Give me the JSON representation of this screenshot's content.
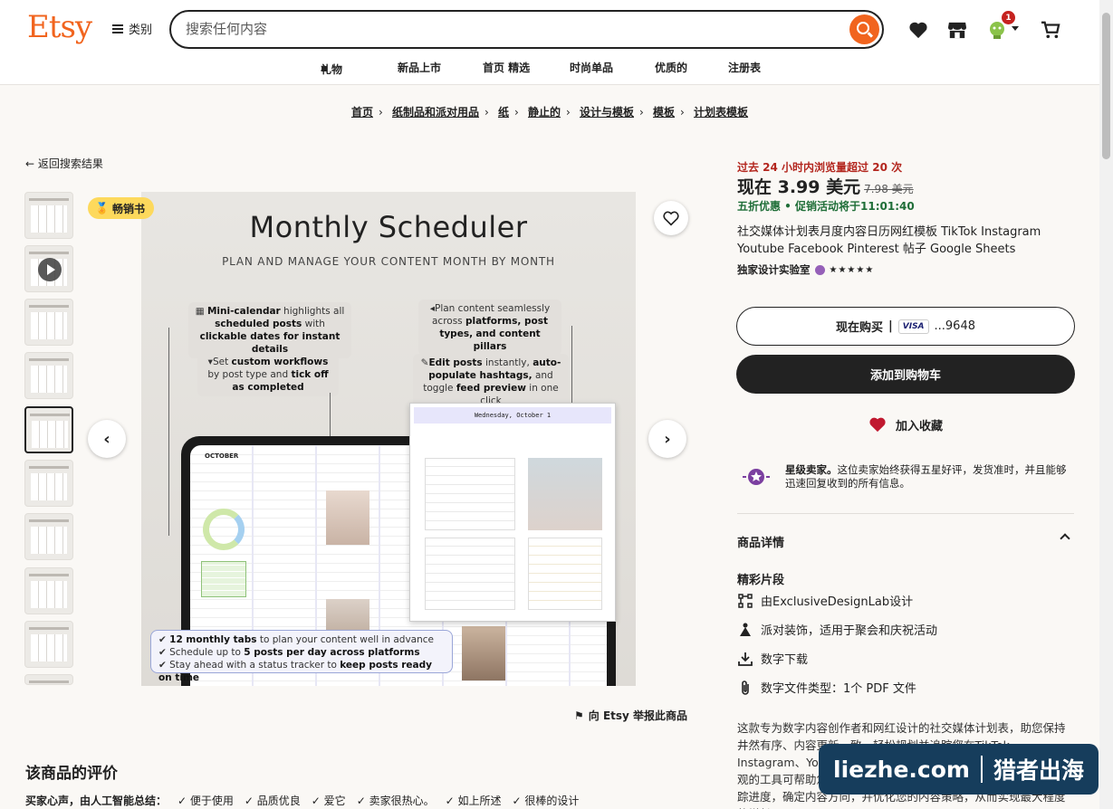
{
  "header": {
    "logo": "Etsy",
    "categories_label": "类别",
    "search_placeholder": "搜索任何内容",
    "cart_badge": "1"
  },
  "subnav": [
    "礼物",
    "新品上市",
    "首页 精选",
    "时尚单品",
    "优质的",
    "注册表"
  ],
  "breadcrumb": [
    "首页",
    "纸制品和派对用品",
    "纸",
    "静止的",
    "设计与模板",
    "模板",
    "计划表模板"
  ],
  "back_link": "返回搜索结果",
  "image": {
    "bestseller": "畅销书",
    "title": "Monthly Scheduler",
    "subtitle": "PLAN AND MANAGE YOUR CONTENT MONTH BY MONTH",
    "callouts": {
      "c1_b1": "Mini-calendar",
      "c1_t1": " highlights all ",
      "c1_b2": "scheduled posts",
      "c1_t2": " with ",
      "c1_b3": "clickable dates for instant details",
      "c2_t1": "Set ",
      "c2_b1": "custom workflows",
      "c2_t2": " by post type and ",
      "c2_b2": "tick off as completed",
      "c3_t1": "Plan content seamlessly across ",
      "c3_b1": "platforms, post types,",
      "c3_t2": " ",
      "c3_b2": "and content pillars",
      "c4_b1": "Edit posts",
      "c4_t1": " instantly, ",
      "c4_b2": "auto-populate hashtags,",
      "c4_t2": " and toggle ",
      "c4_b3": "feed preview",
      "c4_t3": " in one click"
    },
    "popup_header": "Wednesday, October 1",
    "tablet_label": "OCTOBER",
    "bottom": {
      "l1_b": "12 monthly tabs",
      "l1_t": " to plan your content well in advance",
      "l2_t": "Schedule up to ",
      "l2_b": "5 posts per day across platforms",
      "l3_t": "Stay ahead with a status tracker to ",
      "l3_b": "keep posts ready on time"
    }
  },
  "report_label": "向 Etsy 举报此商品",
  "reviews_title": "该商品的评价",
  "ai_summary": {
    "label": "买家心声，由人工智能总结：",
    "tags": [
      "便于使用",
      "品质优良",
      "爱它",
      "卖家很热心。",
      "如上所述",
      "很棒的设计"
    ]
  },
  "product": {
    "views_note": "过去 24 小时内浏览量超过 20 次",
    "price_now": "现在 3.99 美元",
    "price_orig": "7.98 美元",
    "discount": "五折优惠 • 促销活动将于11:01:40",
    "title": "社交媒体计划表月度内容日历网红模板 TikTok Instagram Youtube Facebook Pinterest 帖子 Google Sheets",
    "shop_name": "独家设计实验室",
    "stars": "★★★★★",
    "buy_now": "现在购买",
    "card_brand": "VISA",
    "card_last4": "...9648",
    "add_to_cart": "添加到购物车",
    "add_fav": "加入收藏",
    "star_seller_bold": "星级卖家。",
    "star_seller_text": "这位卖家始终获得五星好评，发货准时，并且能够迅速回复收到的所有信息。",
    "details_header": "商品详情",
    "highlights_title": "精彩片段",
    "highlights": [
      "由ExclusiveDesignLab设计",
      "派对装饰，适用于聚会和庆祝活动",
      "数字下载",
      "数字文件类型：1个 PDF 文件"
    ],
    "description": "这款专为数字内容创作者和网红设计的社交媒体计划表，助您保持井然有序、内容更新一致，轻松规划并追踪您在TikTok、Instagram、YouTube、Facebook和Pinterest上的帖子。这款直观的工具可帮助您规划内容、安排帖子、创意、规划话题标签，跟踪进度，确定内容方向，并优化您的内容策略，从而实现最大程度的增长。"
  },
  "watermark": {
    "left": "liezhe.com",
    "right": "猎者出海"
  }
}
